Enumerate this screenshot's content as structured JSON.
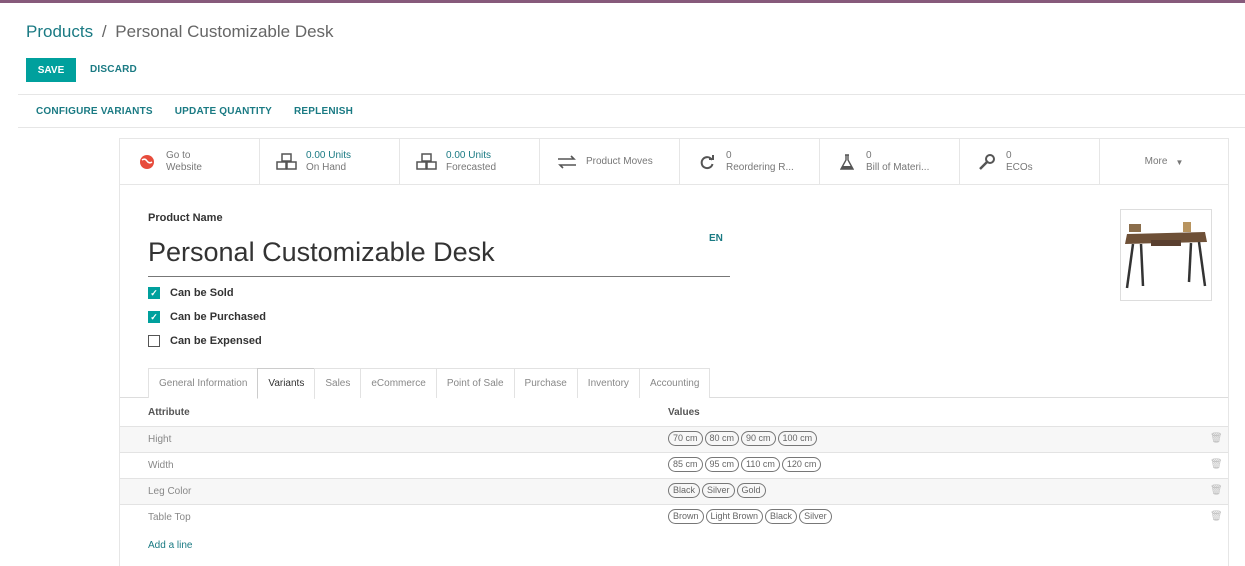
{
  "breadcrumb": {
    "parent": "Products",
    "separator": "/",
    "current": "Personal Customizable Desk"
  },
  "buttons": {
    "save": "SAVE",
    "discard": "DISCARD"
  },
  "actions": [
    "CONFIGURE VARIANTS",
    "UPDATE QUANTITY",
    "REPLENISH"
  ],
  "smart_buttons": [
    {
      "name": "go-to-website",
      "icon": "globe-icon",
      "line1": "Go to",
      "line2": "Website",
      "highlight": false
    },
    {
      "name": "on-hand",
      "icon": "cubes-icon",
      "line1": "0.00 Units",
      "line2": "On Hand",
      "highlight": true
    },
    {
      "name": "forecasted",
      "icon": "cubes-icon",
      "line1": "0.00 Units",
      "line2": "Forecasted",
      "highlight": true
    },
    {
      "name": "product-moves",
      "icon": "exchange-icon",
      "line1": "",
      "line2": "Product Moves",
      "highlight": false
    },
    {
      "name": "reordering-rules",
      "icon": "refresh-icon",
      "line1": "0",
      "line2": "Reordering R...",
      "highlight": false
    },
    {
      "name": "bill-of-materials",
      "icon": "flask-icon",
      "line1": "0",
      "line2": "Bill of Materi...",
      "highlight": false
    },
    {
      "name": "ecos",
      "icon": "wrench-icon",
      "line1": "0",
      "line2": "ECOs",
      "highlight": false
    },
    {
      "name": "more",
      "icon": "caret-down-icon",
      "line1": "",
      "line2": "More",
      "highlight": false
    }
  ],
  "form": {
    "product_name_label": "Product Name",
    "product_name": "Personal Customizable Desk",
    "lang": "EN",
    "checkboxes": [
      {
        "label": "Can be Sold",
        "checked": true
      },
      {
        "label": "Can be Purchased",
        "checked": true
      },
      {
        "label": "Can be Expensed",
        "checked": false
      }
    ]
  },
  "tabs": [
    {
      "label": "General Information",
      "active": false
    },
    {
      "label": "Variants",
      "active": true
    },
    {
      "label": "Sales",
      "active": false
    },
    {
      "label": "eCommerce",
      "active": false
    },
    {
      "label": "Point of Sale",
      "active": false
    },
    {
      "label": "Purchase",
      "active": false
    },
    {
      "label": "Inventory",
      "active": false
    },
    {
      "label": "Accounting",
      "active": false
    }
  ],
  "variants_table": {
    "headers": {
      "attribute": "Attribute",
      "values": "Values"
    },
    "rows": [
      {
        "attribute": "Hight",
        "values": [
          "70 cm",
          "80 cm",
          "90 cm",
          "100 cm"
        ]
      },
      {
        "attribute": "Width",
        "values": [
          "85 cm",
          "95 cm",
          "110 cm",
          "120 cm"
        ]
      },
      {
        "attribute": "Leg Color",
        "values": [
          "Black",
          "Silver",
          "Gold"
        ]
      },
      {
        "attribute": "Table Top",
        "values": [
          "Brown",
          "Light Brown",
          "Black",
          "Silver"
        ]
      }
    ],
    "add_line": "Add a line"
  },
  "colors": {
    "accent": "#00a09d",
    "link": "#1a7a83",
    "brand": "#875a7b",
    "danger": "#e74c3c"
  }
}
